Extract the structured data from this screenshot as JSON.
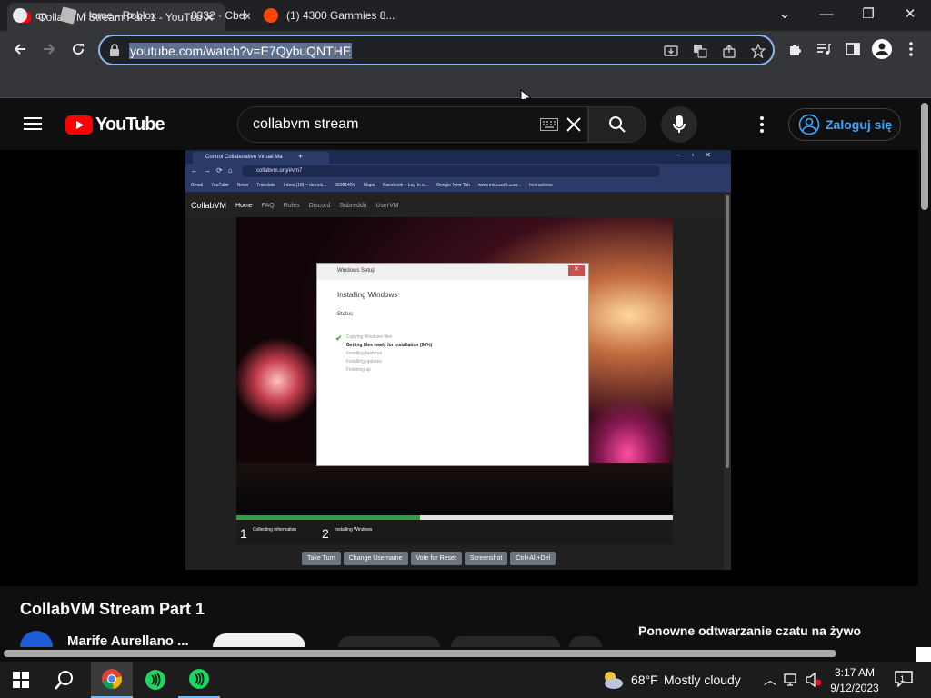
{
  "tab": {
    "title": "CollabVM Stream Part 1 - YouTube"
  },
  "window": {
    "minimize": "—",
    "maximize": "❐",
    "close": "✕",
    "tabsearch": "⌄"
  },
  "omnibox": {
    "url": "youtube.com/watch?v=E7QybuQNTHE"
  },
  "bookmarks": [
    {
      "label": "cp"
    },
    {
      "label": "Home - Roblox"
    },
    {
      "label": "8332 · Cbox"
    },
    {
      "label": "(1) 4300 Gammies 8..."
    }
  ],
  "youtube": {
    "logo_text": "YouTube",
    "search_value": "collabvm stream",
    "signin_label": "Zaloguj się",
    "video_title": "CollabVM Stream Part 1",
    "channel_name": "Marife Aurellano ...",
    "chat_replay": "Ponowne odtwarzanie czatu na żywo"
  },
  "vm": {
    "tab_title": "Control Collaborative Virtual Ma",
    "address": "collabvm.org/#vm7",
    "bookmarks": [
      "Gmail",
      "YouTube",
      "News",
      "Translate",
      "Inbox (18) – derrick...",
      "3938145V",
      "Maps",
      "Facebook – Log In o...",
      "Google New Tab",
      "www.microsoft.com...",
      "Instructions"
    ],
    "nav": [
      "CollabVM",
      "Home",
      "FAQ",
      "Rules",
      "Discord",
      "Subreddit",
      "UserVM"
    ],
    "setup_title": "Windows Setup",
    "setup_heading": "Installing Windows",
    "setup_status": "Status",
    "steps": [
      "Copying Windows files",
      "Getting files ready for installation (94%)",
      "Installing features",
      "Installing updates",
      "Finishing up"
    ],
    "stage1_num": "1",
    "stage1": "Collecting information",
    "stage2_num": "2",
    "stage2": "Installing Windows",
    "progress": 0.42,
    "buttons": [
      "Take Turn",
      "Change Username",
      "Vote for Reset",
      "Screenshot",
      "Ctrl+Alt+Del"
    ]
  },
  "taskbar": {
    "weather_temp": "68°F",
    "weather_text": "Mostly cloudy",
    "time": "3:17 AM",
    "date": "9/12/2023",
    "notif_count": "1"
  },
  "colors": {
    "accent": "#8ab4f8",
    "yt_red": "#ff0000",
    "link_blue": "#3ea6ff"
  }
}
